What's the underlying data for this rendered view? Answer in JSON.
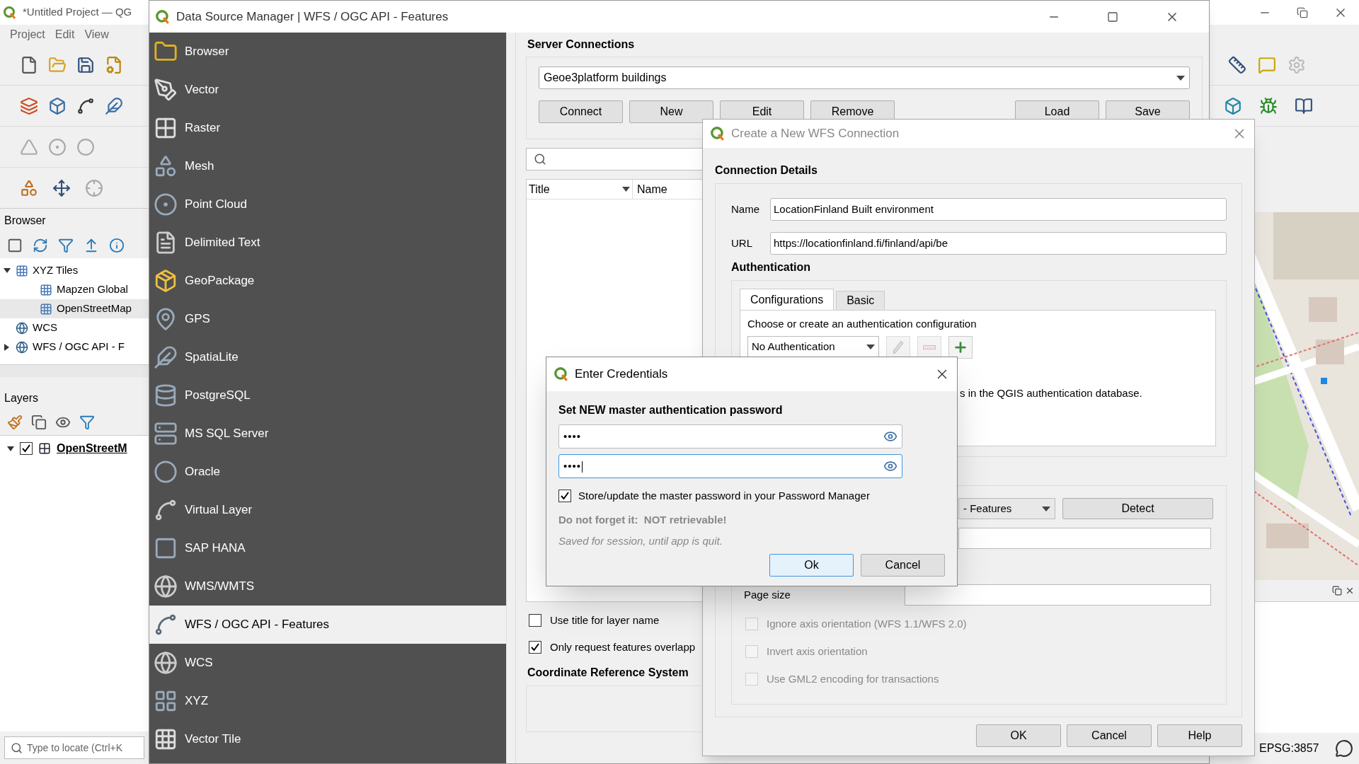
{
  "qgis": {
    "title": "*Untitled Project — QG",
    "menu": [
      "Project",
      "Edit",
      "View"
    ],
    "browser": {
      "title": "Browser",
      "items": [
        {
          "label": "XYZ Tiles",
          "selected": false,
          "expanded": true,
          "children": [
            {
              "label": "Mapzen Global",
              "selected": false
            },
            {
              "label": "OpenStreetMap",
              "selected": true
            }
          ]
        },
        {
          "label": "WCS",
          "selected": false
        },
        {
          "label": "WFS / OGC API - F",
          "selected": false,
          "expanded": false
        }
      ]
    },
    "layers": {
      "title": "Layers",
      "items": [
        {
          "label": "OpenStreetM",
          "checked": true,
          "expanded": true
        }
      ]
    },
    "locator": {
      "placeholder": "Type to locate (Ctrl+K"
    },
    "status_bar": {
      "crs": "EPSG:3857"
    }
  },
  "data_source_manager": {
    "title": "Data Source Manager | WFS / OGC API - Features",
    "providers": [
      {
        "label": "Browser",
        "selected": false
      },
      {
        "label": "Vector",
        "selected": false
      },
      {
        "label": "Raster",
        "selected": false
      },
      {
        "label": "Mesh",
        "selected": false
      },
      {
        "label": "Point Cloud",
        "selected": false
      },
      {
        "label": "Delimited Text",
        "selected": false
      },
      {
        "label": "GeoPackage",
        "selected": false
      },
      {
        "label": "GPS",
        "selected": false
      },
      {
        "label": "SpatiaLite",
        "selected": false
      },
      {
        "label": "PostgreSQL",
        "selected": false
      },
      {
        "label": "MS SQL Server",
        "selected": false
      },
      {
        "label": "Oracle",
        "selected": false
      },
      {
        "label": "Virtual Layer",
        "selected": false
      },
      {
        "label": "SAP HANA",
        "selected": false
      },
      {
        "label": "WMS/WMTS",
        "selected": false
      },
      {
        "label": "WFS / OGC API - Features",
        "selected": true
      },
      {
        "label": "WCS",
        "selected": false
      },
      {
        "label": "XYZ",
        "selected": false
      },
      {
        "label": "Vector Tile",
        "selected": false
      }
    ],
    "server_connections": {
      "title": "Server Connections",
      "connection": "Geoe3platform buildings",
      "buttons": [
        "Connect",
        "New",
        "Edit",
        "Remove"
      ],
      "file_buttons": [
        "Load",
        "Save"
      ]
    },
    "table": {
      "columns": [
        "Title",
        "Name"
      ]
    },
    "options": [
      {
        "label": "Use title for layer name",
        "checked": false
      },
      {
        "label": "Only request features overlapp",
        "checked": true
      }
    ],
    "crs_title": "Coordinate Reference System"
  },
  "wfs_dialog": {
    "title": "Create a New WFS Connection",
    "section": "Connection Details",
    "fields": [
      {
        "label": "Name",
        "value": "LocationFinland Built environment"
      },
      {
        "label": "URL",
        "value": "https://locationfinland.fi/finland/api/be"
      }
    ],
    "authentication": {
      "title": "Authentication",
      "tabs": [
        {
          "label": "Configurations",
          "selected": true
        },
        {
          "label": "Basic",
          "selected": false
        }
      ],
      "prompt": "Choose or create an authentication configuration",
      "config": "No Authentication",
      "note": "s in the QGIS authentication database."
    },
    "version": "- Features",
    "detect_button": "Detect",
    "page_size_label": "Page size",
    "options": [
      {
        "label": "Ignore axis orientation (WFS 1.1/WFS 2.0)",
        "checked": false,
        "disabled": true
      },
      {
        "label": "Invert axis orientation",
        "checked": false,
        "disabled": true
      },
      {
        "label": "Use GML2 encoding for transactions",
        "checked": false,
        "disabled": true
      }
    ],
    "buttons": [
      "OK",
      "Cancel",
      "Help"
    ]
  },
  "credentials_dialog": {
    "title": "Enter Credentials",
    "heading": "Set NEW master authentication password",
    "passwords": [
      {
        "value": "••••",
        "focused": false
      },
      {
        "value": "••••",
        "focused": true
      }
    ],
    "store": {
      "label": "Store/update the master password in your Password Manager",
      "checked": true
    },
    "warning": "Do not forget it:  NOT retrievable!",
    "note": "Saved for session, until app is quit.",
    "buttons": [
      {
        "label": "Ok",
        "default": true
      },
      {
        "label": "Cancel",
        "default": false
      }
    ]
  }
}
